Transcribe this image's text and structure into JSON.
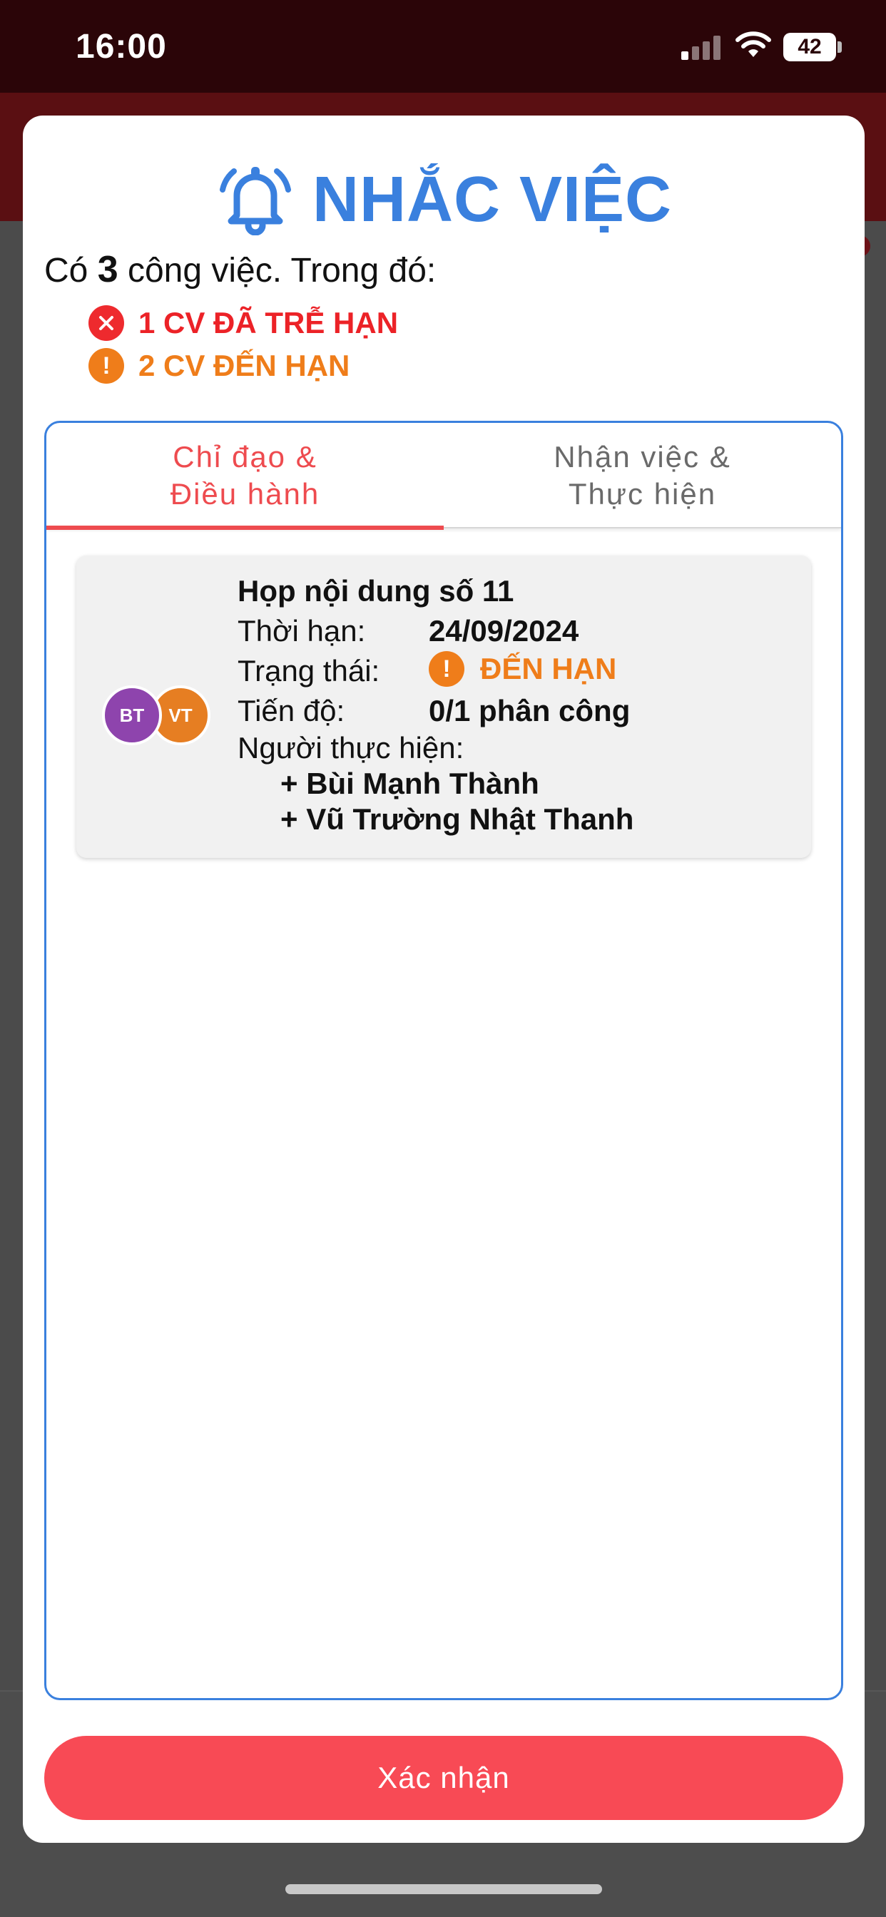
{
  "status_bar": {
    "time": "16:00",
    "battery": "42"
  },
  "modal": {
    "title": "NHẮC VIỆC",
    "summary_prefix": "Có",
    "total_count": "3",
    "summary_suffix": "công việc. Trong đó:",
    "late_text": "1 CV ĐÃ TRỄ HẠN",
    "due_text": "2 CV ĐẾN HẠN",
    "colors": {
      "title": "#3a80de",
      "late": "#ec2227",
      "due": "#ef7d1a",
      "active_tab": "#ee4b4f",
      "confirm": "#f84a55"
    }
  },
  "tabs": [
    {
      "line1": "Chỉ đạo &",
      "line2": "Điều hành",
      "active": true
    },
    {
      "line1": "Nhận việc &",
      "line2": "Thực hiện",
      "active": false
    }
  ],
  "task": {
    "title": "Họp nội dung số 11",
    "deadline_label": "Thời hạn:",
    "deadline_value": "24/09/2024",
    "status_label": "Trạng thái:",
    "status_value": "ĐẾN HẠN",
    "progress_label": "Tiến độ:",
    "progress_value": "0/1 phân công",
    "assignees_label": "Người thực hiện:",
    "assignees": [
      "+ Bùi Mạnh Thành",
      "+ Vũ Trường Nhật Thanh"
    ],
    "avatars": [
      {
        "initials": "BT",
        "color": "#8e44ad"
      },
      {
        "initials": "VT",
        "color": "#e67e22"
      }
    ]
  },
  "confirm_label": "Xác nhận"
}
